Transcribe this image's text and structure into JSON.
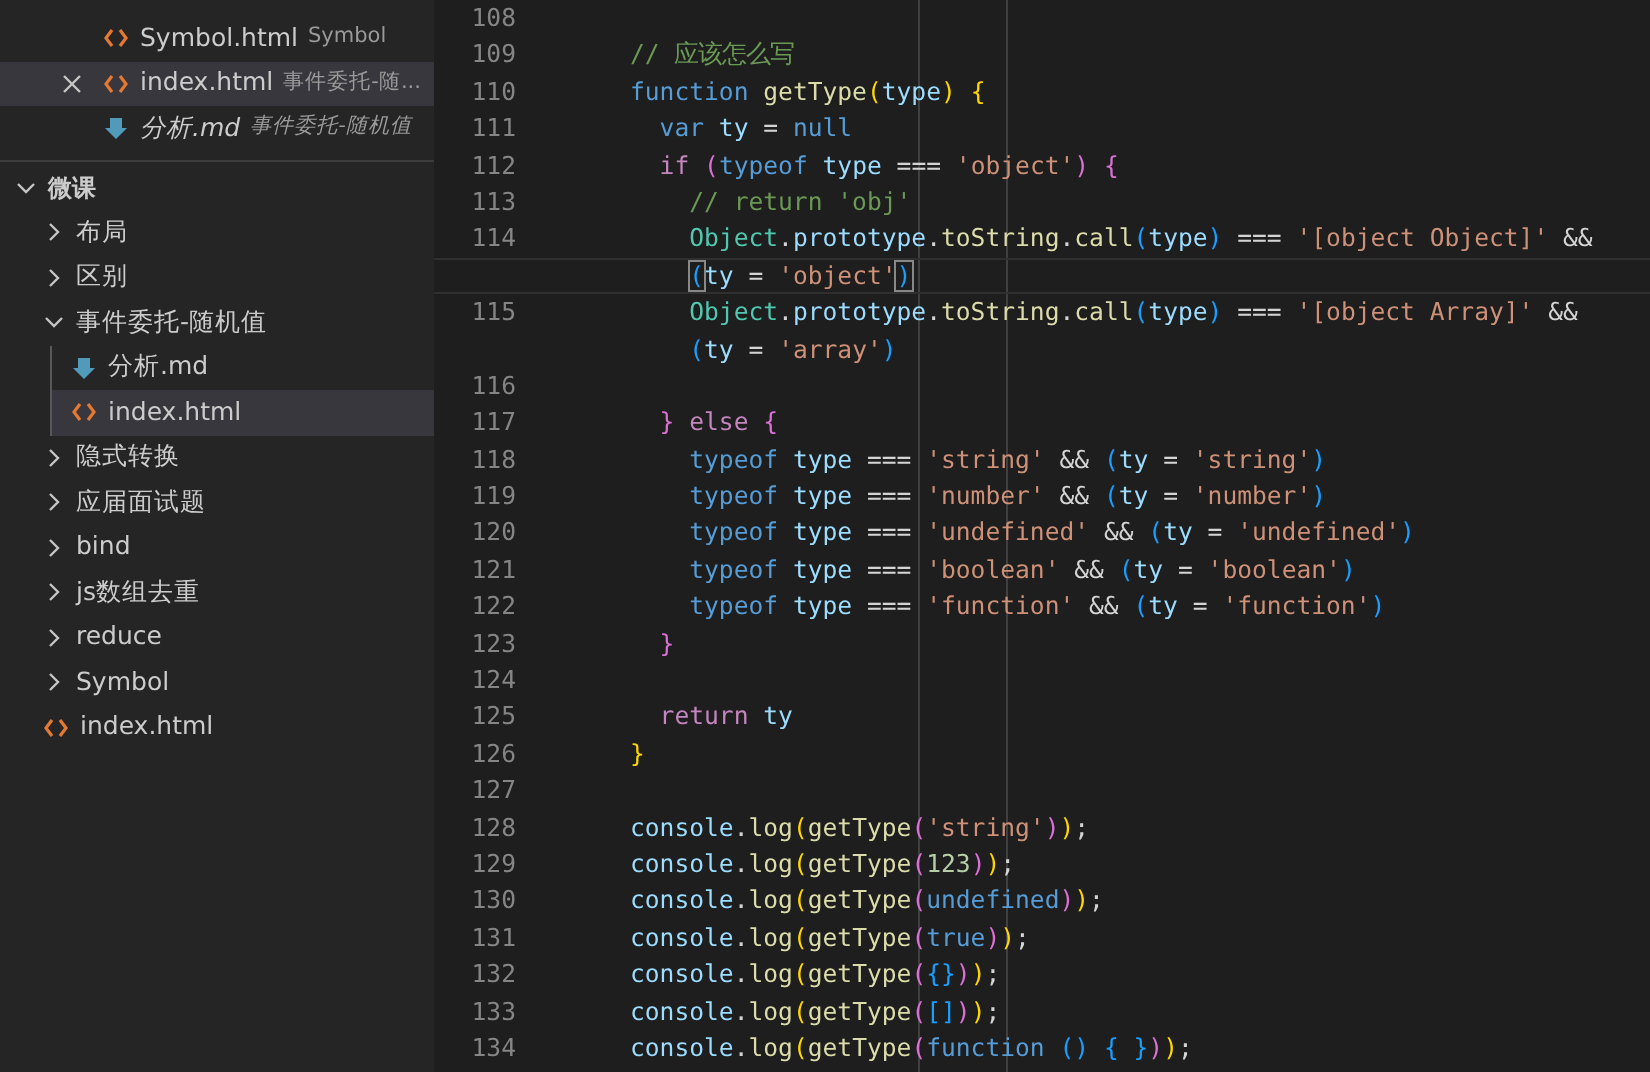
{
  "open_editors": [
    {
      "file": "Symbol.html",
      "folder": "Symbol",
      "kind": "html",
      "active": false,
      "preview": false
    },
    {
      "file": "index.html",
      "folder": "事件委托-随...",
      "kind": "html",
      "active": true,
      "preview": false
    },
    {
      "file": "分析.md",
      "folder": "事件委托-随机值",
      "kind": "markdown",
      "active": false,
      "preview": true
    }
  ],
  "folder": {
    "title": "微课",
    "expanded": true,
    "children": [
      {
        "label": "布局",
        "kind": "folder",
        "expanded": false,
        "selected": false
      },
      {
        "label": "区别",
        "kind": "folder",
        "expanded": false,
        "selected": false
      },
      {
        "label": "事件委托-随机值",
        "kind": "folder",
        "expanded": true,
        "selected": false,
        "children": [
          {
            "label": "分析.md",
            "kind": "markdown",
            "selected": false
          },
          {
            "label": "index.html",
            "kind": "html",
            "selected": true
          }
        ]
      },
      {
        "label": "隐式转换",
        "kind": "folder",
        "expanded": false,
        "selected": false
      },
      {
        "label": "应届面试题",
        "kind": "folder",
        "expanded": false,
        "selected": false
      },
      {
        "label": "bind",
        "kind": "folder",
        "expanded": false,
        "selected": false
      },
      {
        "label": "js数组去重",
        "kind": "folder",
        "expanded": false,
        "selected": false
      },
      {
        "label": "reduce",
        "kind": "folder",
        "expanded": false,
        "selected": false
      },
      {
        "label": "Symbol",
        "kind": "folder",
        "expanded": false,
        "selected": false
      },
      {
        "label": "index.html",
        "kind": "html",
        "selected": false
      }
    ]
  },
  "code_rows": [
    {
      "number": "108",
      "current": false,
      "tokens": []
    },
    {
      "number": "109",
      "current": false,
      "tokens": [
        {
          "kind": "cm",
          "text": "// 应该怎么写"
        }
      ]
    },
    {
      "number": "110",
      "current": false,
      "tokens": [
        {
          "kind": "k",
          "text": "function "
        },
        {
          "kind": "f",
          "text": "getType"
        },
        {
          "kind": "b1",
          "text": "("
        },
        {
          "kind": "v",
          "text": "type"
        },
        {
          "kind": "b1",
          "text": ") "
        },
        {
          "kind": "b1",
          "text": "{"
        }
      ]
    },
    {
      "number": "111",
      "current": false,
      "tokens": [
        {
          "kind": "k",
          "text": "  var "
        },
        {
          "kind": "v",
          "text": "ty "
        },
        {
          "kind": "o",
          "text": "= "
        },
        {
          "kind": "k",
          "text": "null"
        }
      ]
    },
    {
      "number": "112",
      "current": false,
      "tokens": [
        {
          "kind": "c",
          "text": "  if "
        },
        {
          "kind": "b2",
          "text": "("
        },
        {
          "kind": "k",
          "text": "typeof "
        },
        {
          "kind": "v",
          "text": "type "
        },
        {
          "kind": "o",
          "text": "=== "
        },
        {
          "kind": "s",
          "text": "'object'"
        },
        {
          "kind": "b2",
          "text": ") "
        },
        {
          "kind": "b2",
          "text": "{"
        }
      ]
    },
    {
      "number": "113",
      "current": false,
      "tokens": [
        {
          "kind": "cm",
          "text": "    // return 'obj'"
        }
      ]
    },
    {
      "number": "114",
      "current": false,
      "tokens": [
        {
          "kind": "cls",
          "text": "    Object"
        },
        {
          "kind": "o",
          "text": "."
        },
        {
          "kind": "v",
          "text": "prototype"
        },
        {
          "kind": "o",
          "text": "."
        },
        {
          "kind": "f",
          "text": "toString"
        },
        {
          "kind": "o",
          "text": "."
        },
        {
          "kind": "f",
          "text": "call"
        },
        {
          "kind": "b3",
          "text": "("
        },
        {
          "kind": "v",
          "text": "type"
        },
        {
          "kind": "b3",
          "text": ") "
        },
        {
          "kind": "o",
          "text": "=== "
        },
        {
          "kind": "s",
          "text": "'[object Object]' "
        },
        {
          "kind": "o",
          "text": "&&"
        }
      ]
    },
    {
      "current": true,
      "tokens": [
        {
          "kind": "bm",
          "text": "    ("
        },
        {
          "kind": "v",
          "text": "ty "
        },
        {
          "kind": "o",
          "text": "= "
        },
        {
          "kind": "s",
          "text": "'object'"
        },
        {
          "kind": "bm",
          "text": ")"
        }
      ]
    },
    {
      "number": "115",
      "current": false,
      "tokens": [
        {
          "kind": "cls",
          "text": "    Object"
        },
        {
          "kind": "o",
          "text": "."
        },
        {
          "kind": "v",
          "text": "prototype"
        },
        {
          "kind": "o",
          "text": "."
        },
        {
          "kind": "f",
          "text": "toString"
        },
        {
          "kind": "o",
          "text": "."
        },
        {
          "kind": "f",
          "text": "call"
        },
        {
          "kind": "b3",
          "text": "("
        },
        {
          "kind": "v",
          "text": "type"
        },
        {
          "kind": "b3",
          "text": ") "
        },
        {
          "kind": "o",
          "text": "=== "
        },
        {
          "kind": "s",
          "text": "'[object Array]' "
        },
        {
          "kind": "o",
          "text": "&&"
        }
      ]
    },
    {
      "current": false,
      "tokens": [
        {
          "kind": "b3",
          "text": "    ("
        },
        {
          "kind": "v",
          "text": "ty "
        },
        {
          "kind": "o",
          "text": "= "
        },
        {
          "kind": "s",
          "text": "'array'"
        },
        {
          "kind": "b3",
          "text": ")"
        }
      ]
    },
    {
      "number": "116",
      "current": false,
      "tokens": []
    },
    {
      "number": "117",
      "current": false,
      "tokens": [
        {
          "kind": "b2",
          "text": "  } "
        },
        {
          "kind": "c",
          "text": "else "
        },
        {
          "kind": "b2",
          "text": "{"
        }
      ]
    },
    {
      "number": "118",
      "current": false,
      "tokens": [
        {
          "kind": "k",
          "text": "    typeof "
        },
        {
          "kind": "v",
          "text": "type "
        },
        {
          "kind": "o",
          "text": "=== "
        },
        {
          "kind": "s",
          "text": "'string' "
        },
        {
          "kind": "o",
          "text": "&& "
        },
        {
          "kind": "b3",
          "text": "("
        },
        {
          "kind": "v",
          "text": "ty "
        },
        {
          "kind": "o",
          "text": "= "
        },
        {
          "kind": "s",
          "text": "'string'"
        },
        {
          "kind": "b3",
          "text": ")"
        }
      ]
    },
    {
      "number": "119",
      "current": false,
      "tokens": [
        {
          "kind": "k",
          "text": "    typeof "
        },
        {
          "kind": "v",
          "text": "type "
        },
        {
          "kind": "o",
          "text": "=== "
        },
        {
          "kind": "s",
          "text": "'number' "
        },
        {
          "kind": "o",
          "text": "&& "
        },
        {
          "kind": "b3",
          "text": "("
        },
        {
          "kind": "v",
          "text": "ty "
        },
        {
          "kind": "o",
          "text": "= "
        },
        {
          "kind": "s",
          "text": "'number'"
        },
        {
          "kind": "b3",
          "text": ")"
        }
      ]
    },
    {
      "number": "120",
      "current": false,
      "tokens": [
        {
          "kind": "k",
          "text": "    typeof "
        },
        {
          "kind": "v",
          "text": "type "
        },
        {
          "kind": "o",
          "text": "=== "
        },
        {
          "kind": "s",
          "text": "'undefined' "
        },
        {
          "kind": "o",
          "text": "&& "
        },
        {
          "kind": "b3",
          "text": "("
        },
        {
          "kind": "v",
          "text": "ty "
        },
        {
          "kind": "o",
          "text": "= "
        },
        {
          "kind": "s",
          "text": "'undefined'"
        },
        {
          "kind": "b3",
          "text": ")"
        }
      ]
    },
    {
      "number": "121",
      "current": false,
      "tokens": [
        {
          "kind": "k",
          "text": "    typeof "
        },
        {
          "kind": "v",
          "text": "type "
        },
        {
          "kind": "o",
          "text": "=== "
        },
        {
          "kind": "s",
          "text": "'boolean' "
        },
        {
          "kind": "o",
          "text": "&& "
        },
        {
          "kind": "b3",
          "text": "("
        },
        {
          "kind": "v",
          "text": "ty "
        },
        {
          "kind": "o",
          "text": "= "
        },
        {
          "kind": "s",
          "text": "'boolean'"
        },
        {
          "kind": "b3",
          "text": ")"
        }
      ]
    },
    {
      "number": "122",
      "current": false,
      "tokens": [
        {
          "kind": "k",
          "text": "    typeof "
        },
        {
          "kind": "v",
          "text": "type "
        },
        {
          "kind": "o",
          "text": "=== "
        },
        {
          "kind": "s",
          "text": "'function' "
        },
        {
          "kind": "o",
          "text": "&& "
        },
        {
          "kind": "b3",
          "text": "("
        },
        {
          "kind": "v",
          "text": "ty "
        },
        {
          "kind": "o",
          "text": "= "
        },
        {
          "kind": "s",
          "text": "'function'"
        },
        {
          "kind": "b3",
          "text": ")"
        }
      ]
    },
    {
      "number": "123",
      "current": false,
      "tokens": [
        {
          "kind": "b2",
          "text": "  }"
        }
      ]
    },
    {
      "number": "124",
      "current": false,
      "tokens": []
    },
    {
      "number": "125",
      "current": false,
      "tokens": [
        {
          "kind": "c",
          "text": "  return "
        },
        {
          "kind": "v",
          "text": "ty"
        }
      ]
    },
    {
      "number": "126",
      "current": false,
      "tokens": [
        {
          "kind": "b1",
          "text": "}"
        }
      ]
    },
    {
      "number": "127",
      "current": false,
      "tokens": []
    },
    {
      "number": "128",
      "current": false,
      "tokens": [
        {
          "kind": "v",
          "text": "console"
        },
        {
          "kind": "o",
          "text": "."
        },
        {
          "kind": "f",
          "text": "log"
        },
        {
          "kind": "b1",
          "text": "("
        },
        {
          "kind": "f",
          "text": "getType"
        },
        {
          "kind": "b2",
          "text": "("
        },
        {
          "kind": "s",
          "text": "'string'"
        },
        {
          "kind": "b2",
          "text": ")"
        },
        {
          "kind": "b1",
          "text": ")"
        },
        {
          "kind": "o",
          "text": ";"
        }
      ]
    },
    {
      "number": "129",
      "current": false,
      "tokens": [
        {
          "kind": "v",
          "text": "console"
        },
        {
          "kind": "o",
          "text": "."
        },
        {
          "kind": "f",
          "text": "log"
        },
        {
          "kind": "b1",
          "text": "("
        },
        {
          "kind": "f",
          "text": "getType"
        },
        {
          "kind": "b2",
          "text": "("
        },
        {
          "kind": "n",
          "text": "123"
        },
        {
          "kind": "b2",
          "text": ")"
        },
        {
          "kind": "b1",
          "text": ")"
        },
        {
          "kind": "o",
          "text": ";"
        }
      ]
    },
    {
      "number": "130",
      "current": false,
      "tokens": [
        {
          "kind": "v",
          "text": "console"
        },
        {
          "kind": "o",
          "text": "."
        },
        {
          "kind": "f",
          "text": "log"
        },
        {
          "kind": "b1",
          "text": "("
        },
        {
          "kind": "f",
          "text": "getType"
        },
        {
          "kind": "b2",
          "text": "("
        },
        {
          "kind": "k",
          "text": "undefined"
        },
        {
          "kind": "b2",
          "text": ")"
        },
        {
          "kind": "b1",
          "text": ")"
        },
        {
          "kind": "o",
          "text": ";"
        }
      ]
    },
    {
      "number": "131",
      "current": false,
      "tokens": [
        {
          "kind": "v",
          "text": "console"
        },
        {
          "kind": "o",
          "text": "."
        },
        {
          "kind": "f",
          "text": "log"
        },
        {
          "kind": "b1",
          "text": "("
        },
        {
          "kind": "f",
          "text": "getType"
        },
        {
          "kind": "b2",
          "text": "("
        },
        {
          "kind": "k",
          "text": "true"
        },
        {
          "kind": "b2",
          "text": ")"
        },
        {
          "kind": "b1",
          "text": ")"
        },
        {
          "kind": "o",
          "text": ";"
        }
      ]
    },
    {
      "number": "132",
      "current": false,
      "tokens": [
        {
          "kind": "v",
          "text": "console"
        },
        {
          "kind": "o",
          "text": "."
        },
        {
          "kind": "f",
          "text": "log"
        },
        {
          "kind": "b1",
          "text": "("
        },
        {
          "kind": "f",
          "text": "getType"
        },
        {
          "kind": "b2",
          "text": "("
        },
        {
          "kind": "b3",
          "text": "{}"
        },
        {
          "kind": "b2",
          "text": ")"
        },
        {
          "kind": "b1",
          "text": ")"
        },
        {
          "kind": "o",
          "text": ";"
        }
      ]
    },
    {
      "number": "133",
      "current": false,
      "tokens": [
        {
          "kind": "v",
          "text": "console"
        },
        {
          "kind": "o",
          "text": "."
        },
        {
          "kind": "f",
          "text": "log"
        },
        {
          "kind": "b1",
          "text": "("
        },
        {
          "kind": "f",
          "text": "getType"
        },
        {
          "kind": "b2",
          "text": "("
        },
        {
          "kind": "b3",
          "text": "[]"
        },
        {
          "kind": "b2",
          "text": ")"
        },
        {
          "kind": "b1",
          "text": ")"
        },
        {
          "kind": "o",
          "text": ";"
        }
      ]
    },
    {
      "number": "134",
      "current": false,
      "tokens": [
        {
          "kind": "v",
          "text": "console"
        },
        {
          "kind": "o",
          "text": "."
        },
        {
          "kind": "f",
          "text": "log"
        },
        {
          "kind": "b1",
          "text": "("
        },
        {
          "kind": "f",
          "text": "getType"
        },
        {
          "kind": "b2",
          "text": "("
        },
        {
          "kind": "k",
          "text": "function "
        },
        {
          "kind": "b3",
          "text": "() "
        },
        {
          "kind": "b3",
          "text": "{ "
        },
        {
          "kind": "b3",
          "text": "}"
        },
        {
          "kind": "b2",
          "text": ")"
        },
        {
          "kind": "b1",
          "text": ")"
        },
        {
          "kind": "o",
          "text": ";"
        }
      ]
    }
  ]
}
